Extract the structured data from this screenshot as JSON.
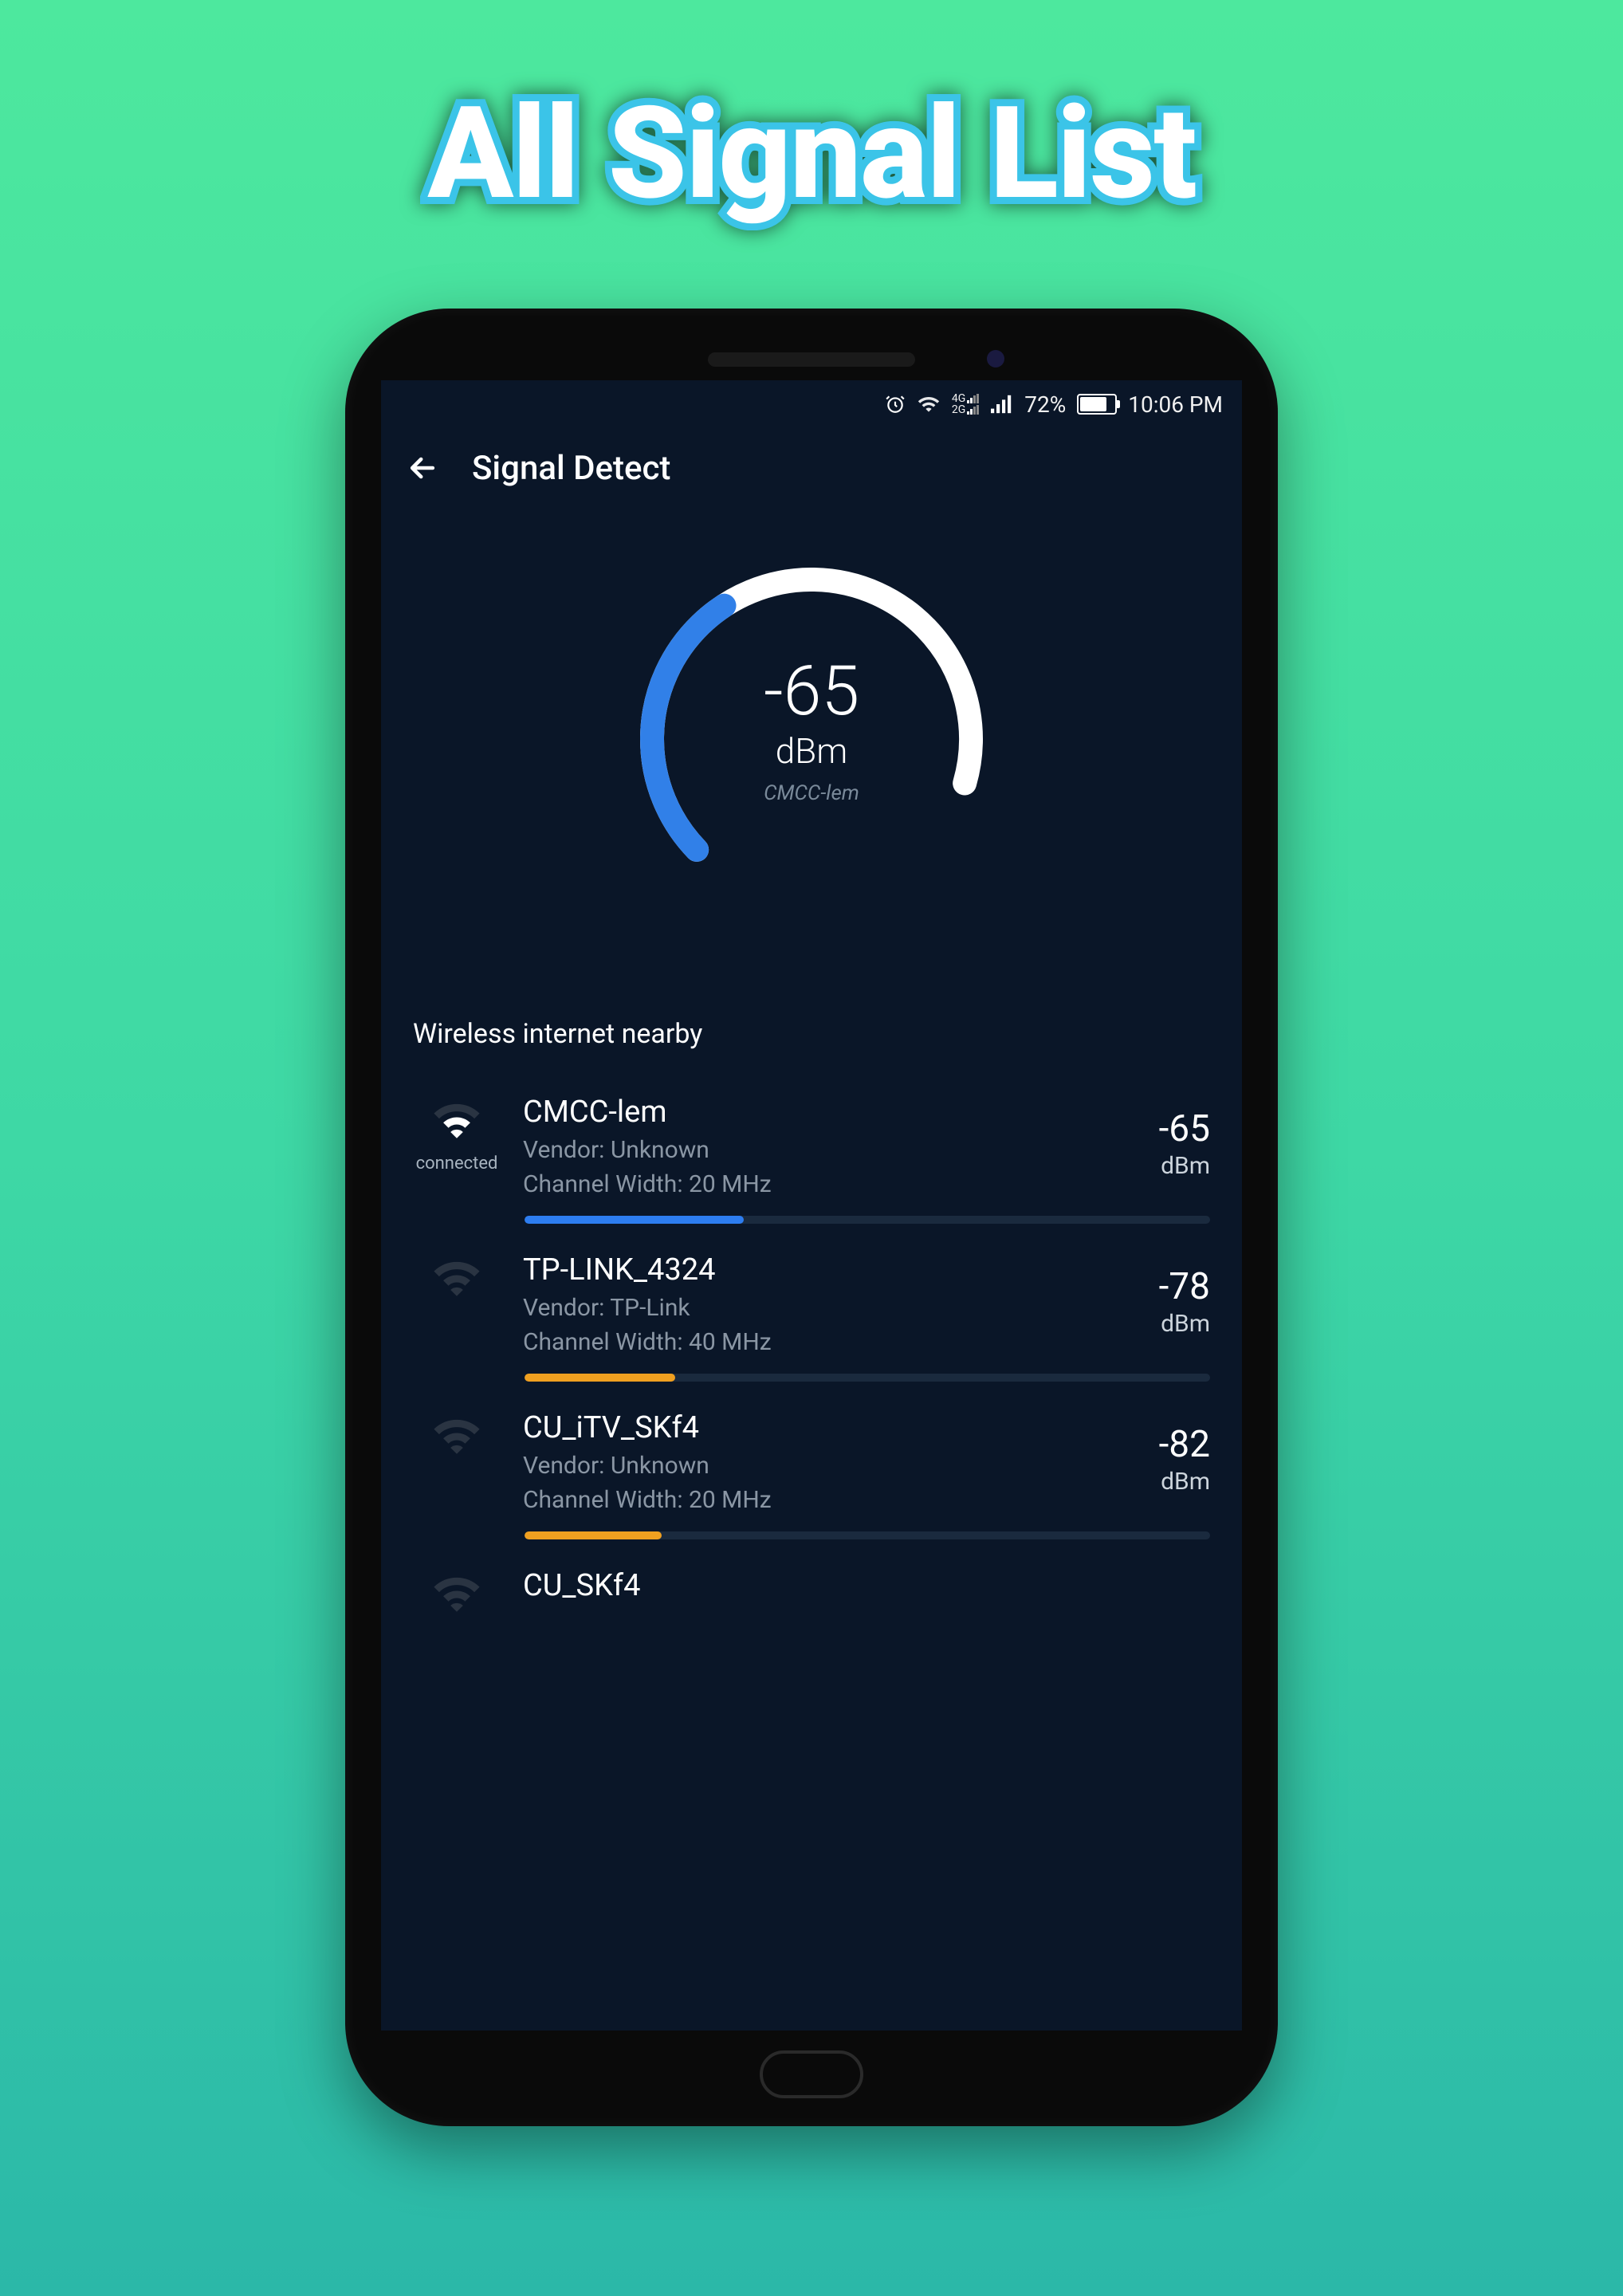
{
  "marketing": {
    "title": "All Signal List"
  },
  "status_bar": {
    "battery_pct": "72%",
    "time": "10:06 PM",
    "net_label_top": "4G",
    "net_label_bot": "2G"
  },
  "app_bar": {
    "title": "Signal Detect"
  },
  "gauge": {
    "value": "-65",
    "unit": "dBm",
    "label": "CMCC-lem",
    "fill_pct": 42
  },
  "section": {
    "nearby": "Wireless internet nearby"
  },
  "networks": [
    {
      "name": "CMCC-lem",
      "vendor": "Vendor: Unknown",
      "channel": "Channel Width: 20 MHz",
      "signal": "-65",
      "unit": "dBm",
      "connected": "connected",
      "bar_pct": 32,
      "bar_color": "#2d7df0",
      "wifi_level": 2
    },
    {
      "name": "TP-LINK_4324",
      "vendor": "Vendor: TP-Link",
      "channel": "Channel Width: 40 MHz",
      "signal": "-78",
      "unit": "dBm",
      "connected": "",
      "bar_pct": 22,
      "bar_color": "#f0a020",
      "wifi_level": 0
    },
    {
      "name": "CU_iTV_SKf4",
      "vendor": "Vendor: Unknown",
      "channel": "Channel Width: 20 MHz",
      "signal": "-82",
      "unit": "dBm",
      "connected": "",
      "bar_pct": 20,
      "bar_color": "#f0a020",
      "wifi_level": 0
    },
    {
      "name": "CU_SKf4",
      "vendor": "",
      "channel": "",
      "signal": "",
      "unit": "",
      "connected": "",
      "bar_pct": 0,
      "bar_color": "",
      "wifi_level": 0
    }
  ],
  "colors": {
    "gauge_fill": "#3180e8",
    "gauge_empty": "#ffffff",
    "bg": "#0a1628"
  }
}
